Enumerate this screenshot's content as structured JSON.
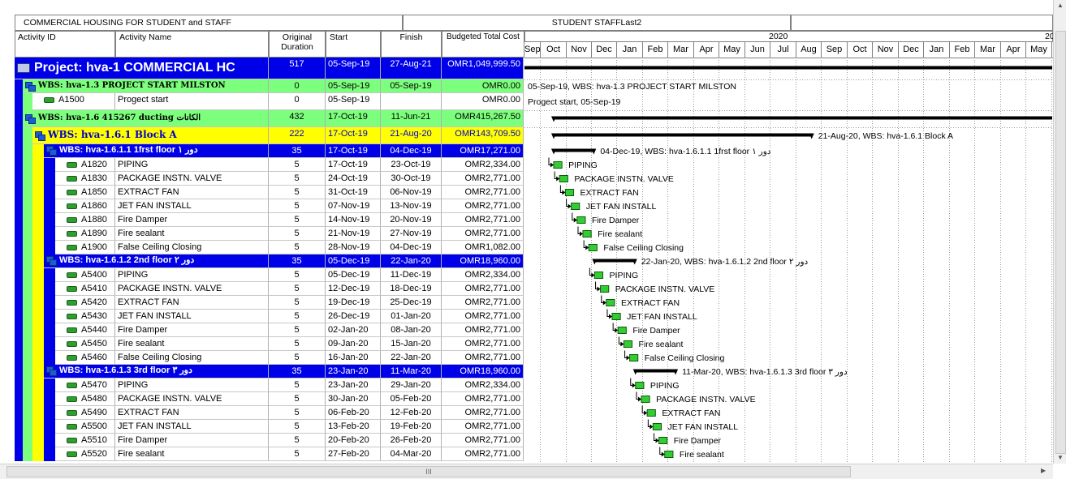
{
  "header": {
    "project_title": "COMMERCIAL HOUSING FOR STUDENT and STAFF",
    "layout_name": "STUDENT STAFFLast2"
  },
  "columns": {
    "activity_id": "Activity ID",
    "activity_name": "Activity Name",
    "original_duration": "Original Duration",
    "start": "Start",
    "finish": "Finish",
    "budget": "Budgeted Total Cost"
  },
  "timescale": {
    "year_2020": "2020",
    "year_2021": "20",
    "months": [
      "Sep",
      "Oct",
      "Nov",
      "Dec",
      "Jan",
      "Feb",
      "Mar",
      "Apr",
      "May",
      "Jun",
      "Jul",
      "Aug",
      "Sep",
      "Oct",
      "Nov",
      "Dec",
      "Jan",
      "Feb",
      "Mar",
      "Apr",
      "May"
    ]
  },
  "rows": [
    {
      "type": "project",
      "level": 0,
      "id": "",
      "name": "Project: hva-1  COMMERCIAL HC",
      "dur": "517",
      "start": "05-Sep-19",
      "finish": "27-Aug-21",
      "cost": "OMR1,049,999.50",
      "bar_label": ""
    },
    {
      "type": "wbs-green",
      "level": 1,
      "id": "",
      "name": "WBS: hva-1.3  PROJECT START MILSTON",
      "dur": "0",
      "start": "05-Sep-19",
      "finish": "05-Sep-19",
      "cost": "OMR0.00",
      "bar_label": "05-Sep-19, WBS: hva-1.3  PROJECT START MILSTON"
    },
    {
      "type": "activity",
      "level": 2,
      "id": "A1500",
      "name": "Progect start",
      "dur": "0",
      "start": "05-Sep-19",
      "finish": "",
      "cost": "OMR0.00",
      "bar_label": "Progect start, 05-Sep-19"
    },
    {
      "type": "wbs-green",
      "level": 1,
      "id": "",
      "name": "WBS: hva-1.6  415267 ducting الكانات",
      "dur": "432",
      "start": "17-Oct-19",
      "finish": "11-Jun-21",
      "cost": "OMR415,267.50",
      "bar_label": ""
    },
    {
      "type": "wbs-yellow",
      "level": 2,
      "id": "",
      "name": "WBS: hva-1.6.1  Block A",
      "dur": "222",
      "start": "17-Oct-19",
      "finish": "21-Aug-20",
      "cost": "OMR143,709.50",
      "bar_label": "21-Aug-20, WBS: hva-1.6.1  Block A"
    },
    {
      "type": "wbs-blue",
      "level": 3,
      "id": "",
      "name": "WBS: hva-1.6.1.1  1frst floor دور ١",
      "dur": "35",
      "start": "17-Oct-19",
      "finish": "04-Dec-19",
      "cost": "OMR17,271.00",
      "bar_label": "04-Dec-19, WBS: hva-1.6.1.1  1frst floor دور ١"
    },
    {
      "type": "activity",
      "level": 4,
      "id": "A1820",
      "name": "PIPING",
      "dur": "5",
      "start": "17-Oct-19",
      "finish": "23-Oct-19",
      "cost": "OMR2,334.00",
      "bar_label": "PIPING"
    },
    {
      "type": "activity",
      "level": 4,
      "id": "A1830",
      "name": "PACKAGE INSTN. VALVE",
      "dur": "5",
      "start": "24-Oct-19",
      "finish": "30-Oct-19",
      "cost": "OMR2,771.00",
      "bar_label": "PACKAGE INSTN. VALVE"
    },
    {
      "type": "activity",
      "level": 4,
      "id": "A1850",
      "name": "EXTRACT FAN",
      "dur": "5",
      "start": "31-Oct-19",
      "finish": "06-Nov-19",
      "cost": "OMR2,771.00",
      "bar_label": "EXTRACT FAN"
    },
    {
      "type": "activity",
      "level": 4,
      "id": "A1860",
      "name": "JET  FAN  INSTALL",
      "dur": "5",
      "start": "07-Nov-19",
      "finish": "13-Nov-19",
      "cost": "OMR2,771.00",
      "bar_label": "JET  FAN  INSTALL"
    },
    {
      "type": "activity",
      "level": 4,
      "id": "A1880",
      "name": "Fire Damper",
      "dur": "5",
      "start": "14-Nov-19",
      "finish": "20-Nov-19",
      "cost": "OMR2,771.00",
      "bar_label": "Fire Damper"
    },
    {
      "type": "activity",
      "level": 4,
      "id": "A1890",
      "name": "Fire sealant",
      "dur": "5",
      "start": "21-Nov-19",
      "finish": "27-Nov-19",
      "cost": "OMR2,771.00",
      "bar_label": "Fire sealant"
    },
    {
      "type": "activity",
      "level": 4,
      "id": "A1900",
      "name": "False Ceiling Closing",
      "dur": "5",
      "start": "28-Nov-19",
      "finish": "04-Dec-19",
      "cost": "OMR1,082.00",
      "bar_label": "False Ceiling Closing"
    },
    {
      "type": "wbs-blue",
      "level": 3,
      "id": "",
      "name": "WBS: hva-1.6.1.2  2nd floor دور ٢",
      "dur": "35",
      "start": "05-Dec-19",
      "finish": "22-Jan-20",
      "cost": "OMR18,960.00",
      "bar_label": "22-Jan-20, WBS: hva-1.6.1.2  2nd floor  دور ٢"
    },
    {
      "type": "activity",
      "level": 4,
      "id": "A5400",
      "name": "PIPING",
      "dur": "5",
      "start": "05-Dec-19",
      "finish": "11-Dec-19",
      "cost": "OMR2,334.00",
      "bar_label": "PIPING"
    },
    {
      "type": "activity",
      "level": 4,
      "id": "A5410",
      "name": "PACKAGE INSTN. VALVE",
      "dur": "5",
      "start": "12-Dec-19",
      "finish": "18-Dec-19",
      "cost": "OMR2,771.00",
      "bar_label": "PACKAGE INSTN. VALVE"
    },
    {
      "type": "activity",
      "level": 4,
      "id": "A5420",
      "name": "EXTRACT FAN",
      "dur": "5",
      "start": "19-Dec-19",
      "finish": "25-Dec-19",
      "cost": "OMR2,771.00",
      "bar_label": "EXTRACT FAN"
    },
    {
      "type": "activity",
      "level": 4,
      "id": "A5430",
      "name": "JET  FAN  INSTALL",
      "dur": "5",
      "start": "26-Dec-19",
      "finish": "01-Jan-20",
      "cost": "OMR2,771.00",
      "bar_label": "JET  FAN  INSTALL"
    },
    {
      "type": "activity",
      "level": 4,
      "id": "A5440",
      "name": "Fire Damper",
      "dur": "5",
      "start": "02-Jan-20",
      "finish": "08-Jan-20",
      "cost": "OMR2,771.00",
      "bar_label": "Fire Damper"
    },
    {
      "type": "activity",
      "level": 4,
      "id": "A5450",
      "name": "Fire sealant",
      "dur": "5",
      "start": "09-Jan-20",
      "finish": "15-Jan-20",
      "cost": "OMR2,771.00",
      "bar_label": "Fire sealant"
    },
    {
      "type": "activity",
      "level": 4,
      "id": "A5460",
      "name": "False Ceiling Closing",
      "dur": "5",
      "start": "16-Jan-20",
      "finish": "22-Jan-20",
      "cost": "OMR2,771.00",
      "bar_label": "False Ceiling Closing"
    },
    {
      "type": "wbs-blue",
      "level": 3,
      "id": "",
      "name": "WBS: hva-1.6.1.3  3rd floor دور ٣",
      "dur": "35",
      "start": "23-Jan-20",
      "finish": "11-Mar-20",
      "cost": "OMR18,960.00",
      "bar_label": "11-Mar-20, WBS: hva-1.6.1.3  3rd floor دور ٣"
    },
    {
      "type": "activity",
      "level": 4,
      "id": "A5470",
      "name": "PIPING",
      "dur": "5",
      "start": "23-Jan-20",
      "finish": "29-Jan-20",
      "cost": "OMR2,334.00",
      "bar_label": "PIPING"
    },
    {
      "type": "activity",
      "level": 4,
      "id": "A5480",
      "name": "PACKAGE INSTN. VALVE",
      "dur": "5",
      "start": "30-Jan-20",
      "finish": "05-Feb-20",
      "cost": "OMR2,771.00",
      "bar_label": "PACKAGE INSTN. VALVE"
    },
    {
      "type": "activity",
      "level": 4,
      "id": "A5490",
      "name": "EXTRACT FAN",
      "dur": "5",
      "start": "06-Feb-20",
      "finish": "12-Feb-20",
      "cost": "OMR2,771.00",
      "bar_label": "EXTRACT FAN"
    },
    {
      "type": "activity",
      "level": 4,
      "id": "A5500",
      "name": "JET  FAN  INSTALL",
      "dur": "5",
      "start": "13-Feb-20",
      "finish": "19-Feb-20",
      "cost": "OMR2,771.00",
      "bar_label": "JET  FAN  INSTALL"
    },
    {
      "type": "activity",
      "level": 4,
      "id": "A5510",
      "name": "Fire Damper",
      "dur": "5",
      "start": "20-Feb-20",
      "finish": "26-Feb-20",
      "cost": "OMR2,771.00",
      "bar_label": "Fire Damper"
    },
    {
      "type": "activity",
      "level": 4,
      "id": "A5520",
      "name": "Fire sealant",
      "dur": "5",
      "start": "27-Feb-20",
      "finish": "04-Mar-20",
      "cost": "OMR2,771.00",
      "bar_label": "Fire sealant"
    }
  ],
  "colors": {
    "project_bg": "#0000e8",
    "wbs_green": "#7cff7c",
    "wbs_yellow": "#ffff00",
    "wbs_blue": "#0000e8",
    "activity_bar": "#33cc33",
    "summary_bar": "#000000"
  },
  "scroll": {
    "hscroll_grip": "III"
  }
}
